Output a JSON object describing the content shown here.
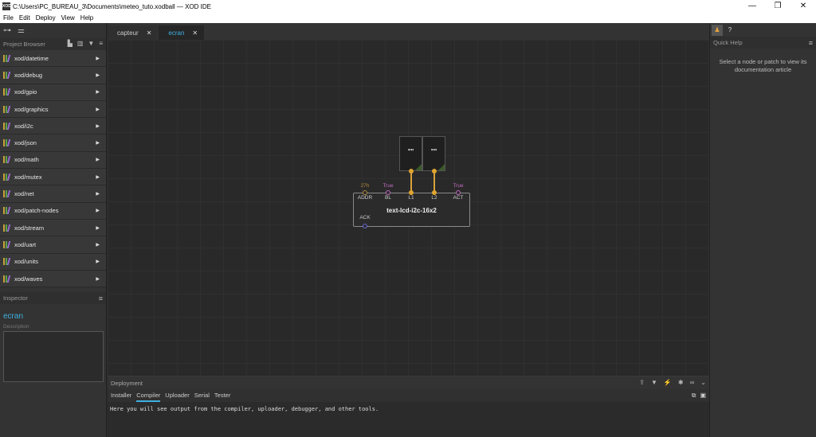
{
  "window": {
    "title": "C:\\Users\\PC_BUREAU_3\\Documents\\meteo_tuto.xodball — XOD IDE",
    "app_icon": "XOD",
    "minimize": "—",
    "maximize": "❐",
    "close": "✕"
  },
  "menu": [
    "File",
    "Edit",
    "Deploy",
    "View",
    "Help"
  ],
  "project_browser": {
    "title": "Project Browser",
    "libraries": [
      "xod/datetime",
      "xod/debug",
      "xod/gpio",
      "xod/graphics",
      "xod/i2c",
      "xod/json",
      "xod/math",
      "xod/mutex",
      "xod/net",
      "xod/patch-nodes",
      "xod/stream",
      "xod/uart",
      "xod/units",
      "xod/waves"
    ]
  },
  "inspector": {
    "title": "Inspector",
    "patch_name": "ecran",
    "description_label": "Description",
    "description_value": ""
  },
  "tabs": [
    {
      "label": "capteur",
      "active": false
    },
    {
      "label": "ecran",
      "active": true
    }
  ],
  "canvas": {
    "constants": [
      {
        "value": "\"\""
      },
      {
        "value": "\"\""
      }
    ],
    "node": {
      "title": "text-lcd-i2c-16x2",
      "pins": [
        {
          "label": "ADDR",
          "value": "27h"
        },
        {
          "label": "BL",
          "value": "True"
        },
        {
          "label": "L1",
          "value": ""
        },
        {
          "label": "L2",
          "value": ""
        },
        {
          "label": "ACT",
          "value": "True"
        }
      ],
      "output_pin": "ACK"
    },
    "colors": {
      "byte_pin": "#b0893a",
      "boolean_pin": "#c46ac4",
      "string_pin": "#e0a530",
      "pulse_pin": "#6a6ad8"
    }
  },
  "deployment": {
    "title": "Deployment",
    "tabs": [
      "Installer",
      "Compiler",
      "Uploader",
      "Serial",
      "Tester"
    ],
    "active_tab": "Compiler",
    "output": "Here you will see output from the compiler, uploader, debugger, and other tools."
  },
  "quick_help": {
    "title": "Quick Help",
    "message": "Select a node or patch to view its documentation article"
  }
}
